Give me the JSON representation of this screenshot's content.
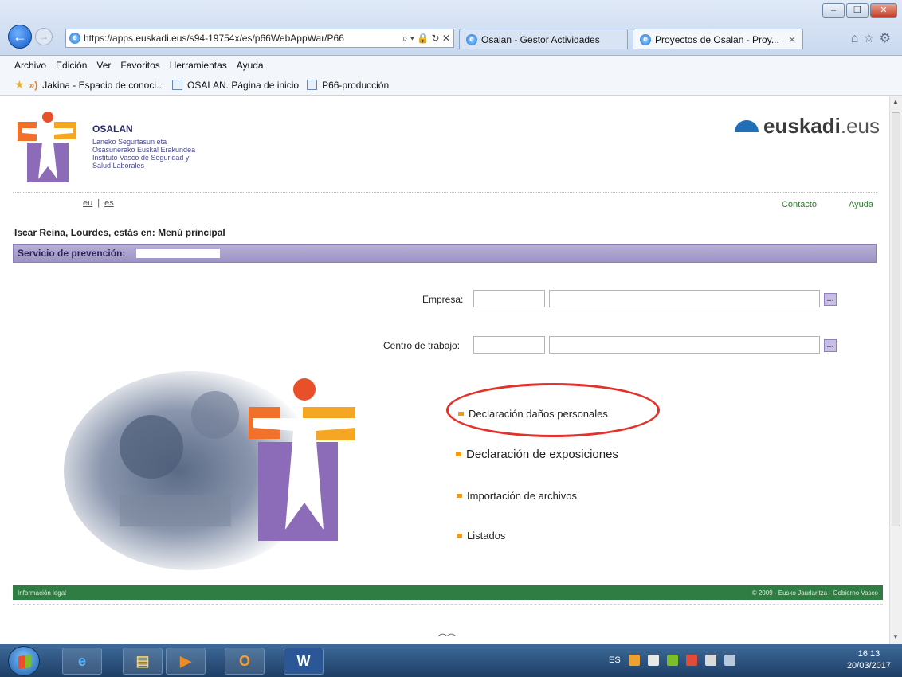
{
  "browser": {
    "url": "https://apps.euskadi.eus/s94-19754x/es/p66WebAppWar/P66",
    "address_icons": "⌕ ▾ 🔒 ↻ ✕",
    "tabs": [
      {
        "label": "Osalan - Gestor Actividades"
      },
      {
        "label": "Proyectos de Osalan - Proy...",
        "close": "✕"
      }
    ],
    "menu": [
      "Archivo",
      "Edición",
      "Ver",
      "Favoritos",
      "Herramientas",
      "Ayuda"
    ],
    "favorites": [
      "Jakina - Espacio de conoci...",
      "OSALAN. Página de inicio",
      "P66-producción"
    ]
  },
  "header": {
    "org_name": "OSALAN",
    "org_line1": "Laneko Segurtasun eta",
    "org_line2": "Osasunerako Euskal Erakundea",
    "org_line3": "Instituto Vasco de Seguridad y",
    "org_line4": "Salud Laborales",
    "brand_main": "euskadi",
    "brand_suffix": ".eus"
  },
  "langs": {
    "eu": "eu",
    "es": "es",
    "sep": "|"
  },
  "top_links": {
    "contact": "Contacto",
    "help": "Ayuda"
  },
  "breadcrumb": "Iscar Reina, Lourdes, estás en:  Menú principal",
  "band_label": "Servicio de prevención:",
  "form": {
    "empresa_label": "Empresa:",
    "centro_label": "Centro de trabajo:",
    "lookup": "..."
  },
  "menu_links": [
    "Declaración daños personales",
    "Declaración de exposiciones",
    "Importación de archivos",
    "Listados"
  ],
  "footer": {
    "left": "Información legal",
    "right": "© 2009 - Eusko Jaurlaritza - Gobierno Vasco"
  },
  "taskbar": {
    "lang": "ES",
    "time": "16:13",
    "date": "20/03/2017"
  },
  "colors": {
    "osalan_purple": "#9d93c5",
    "footer_green": "#2f7d43",
    "bullet_orange": "#f39a12",
    "annotation_red": "#e2322b"
  }
}
